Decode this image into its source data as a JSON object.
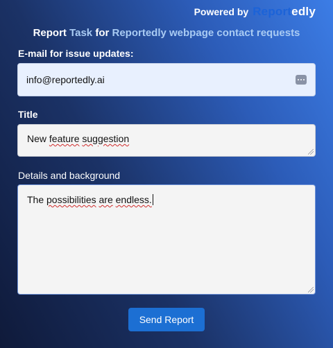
{
  "header": {
    "powered_by": "Powered by",
    "logo_part1": "Report",
    "logo_part2": "edly"
  },
  "title": {
    "part1": "Report ",
    "part2": "Task ",
    "part3": "for ",
    "part4": "Reportedly webpage contact requests"
  },
  "email": {
    "label": "E-mail for issue updates:",
    "value": "info@reportedly.ai",
    "autofill_icon": "autofill-dots-icon"
  },
  "title_field": {
    "label": "Title",
    "value_word1": "New ",
    "value_word2": "feature",
    "value_word3": " ",
    "value_word4": "suggestion"
  },
  "details_field": {
    "label": "Details and background",
    "value_word1": "The ",
    "value_word2": "possibilities",
    "value_word3": " ",
    "value_word4": "are",
    "value_word5": " ",
    "value_word6": "endless."
  },
  "send_button": {
    "label": "Send Report"
  },
  "colors": {
    "accent": "#1c6fd3",
    "logo_blue": "#1c63d8",
    "title_highlight": "#a9cbf3"
  }
}
